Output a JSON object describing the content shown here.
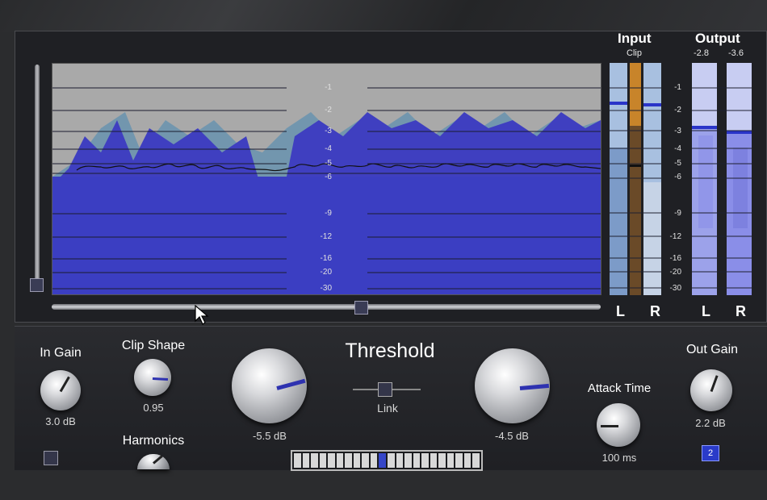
{
  "display": {
    "scale_labels": [
      "-1",
      "-2",
      "-3",
      "-4",
      "-5",
      "-6",
      "-9",
      "-12",
      "-16",
      "-20",
      "-30"
    ]
  },
  "meters": {
    "input": {
      "title": "Input",
      "sub": "Clip",
      "left": "L",
      "right": "R"
    },
    "output": {
      "title": "Output",
      "left_peak": "-2.8",
      "right_peak": "-3.6",
      "left": "L",
      "right": "R"
    },
    "scale_labels": [
      "-1",
      "-2",
      "-3",
      "-4",
      "-5",
      "-6",
      "-9",
      "-12",
      "-16",
      "-20",
      "-30"
    ]
  },
  "controls": {
    "in_gain": {
      "label": "In Gain",
      "value": "3.0 dB"
    },
    "clip_shape": {
      "label": "Clip Shape",
      "value": "0.95"
    },
    "harmonics": {
      "label": "Harmonics"
    },
    "threshold": {
      "label": "Threshold",
      "left_value": "-5.5 dB",
      "right_value": "-4.5 dB",
      "link_label": "Link"
    },
    "attack_time": {
      "label": "Attack Time",
      "value": "100 ms"
    },
    "out_gain": {
      "label": "Out Gain",
      "value": "2.2 dB",
      "badge": "2"
    }
  },
  "colors": {
    "waveform": "#3f3fc0",
    "waveform_light": "#5b8fb0",
    "clip_meter": "#c8842a",
    "meter_blue": "#8a8ee8"
  }
}
